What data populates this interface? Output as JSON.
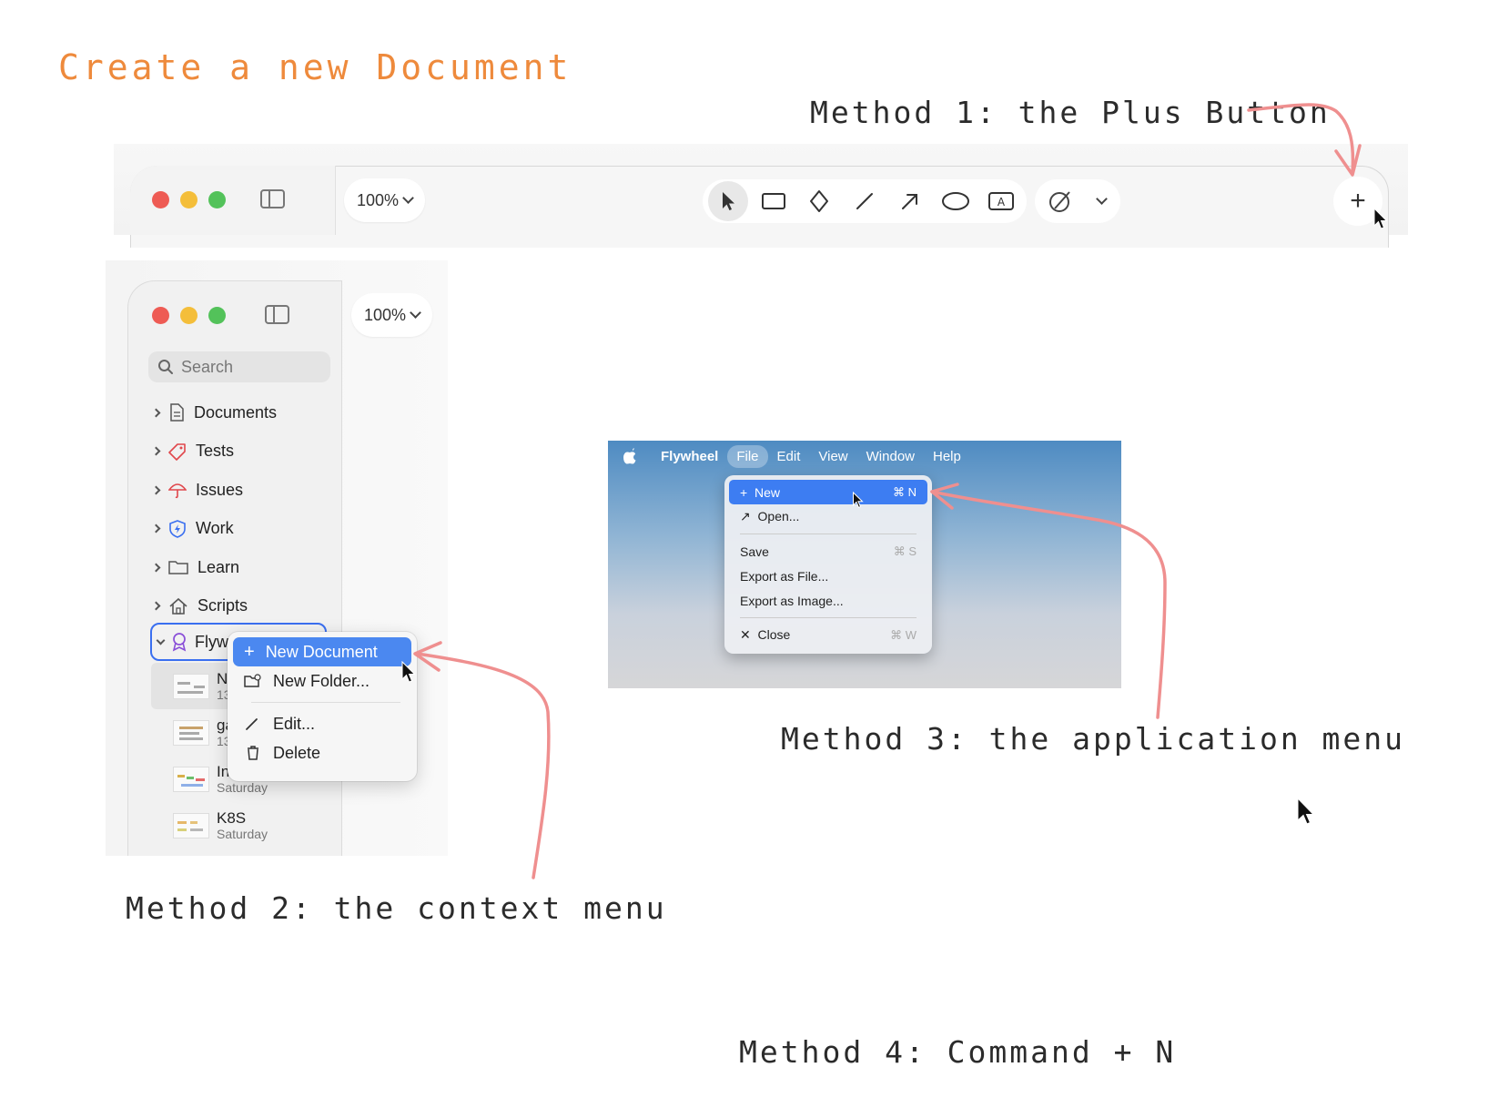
{
  "captions": {
    "title": "Create a new Document",
    "method1": "Method 1: the Plus Button",
    "method2": "Method 2: the context menu",
    "method3": "Method 3: the application menu",
    "method4": "Method 4: Command + N"
  },
  "toolbar": {
    "zoom": "100%",
    "plus": "+",
    "tools": [
      "select",
      "rectangle",
      "diamond",
      "line",
      "arrow",
      "ellipse",
      "text"
    ]
  },
  "sidebar": {
    "zoom": "100%",
    "search_placeholder": "Search",
    "items": [
      {
        "label": "Documents",
        "icon": "document-icon"
      },
      {
        "label": "Tests",
        "icon": "tag-icon"
      },
      {
        "label": "Issues",
        "icon": "umbrella-icon"
      },
      {
        "label": "Work",
        "icon": "shield-icon"
      },
      {
        "label": "Learn",
        "icon": "folder-icon"
      },
      {
        "label": "Scripts",
        "icon": "house-icon"
      }
    ],
    "expanded_item": "Flyw",
    "documents": [
      {
        "name": "N",
        "date": "13"
      },
      {
        "name": "ga",
        "date": "13"
      },
      {
        "name": "In",
        "date": "Saturday"
      },
      {
        "name": "K8S",
        "date": "Saturday"
      }
    ]
  },
  "context_menu": {
    "new_document": "New Document",
    "new_folder": "New Folder...",
    "edit": "Edit...",
    "delete": "Delete"
  },
  "app_menu": {
    "menubar": [
      "Flywheel",
      "File",
      "Edit",
      "View",
      "Window",
      "Help"
    ],
    "items": {
      "new": "New",
      "new_sc": "⌘ N",
      "open": "Open...",
      "save": "Save",
      "save_sc": "⌘ S",
      "export_file": "Export as File...",
      "export_image": "Export as Image...",
      "close": "Close",
      "close_sc": "⌘ W"
    }
  },
  "colors": {
    "title_orange": "#ee8a3c",
    "arrow_pink": "#ef8f8f",
    "highlight_blue": "#4b88f0"
  }
}
